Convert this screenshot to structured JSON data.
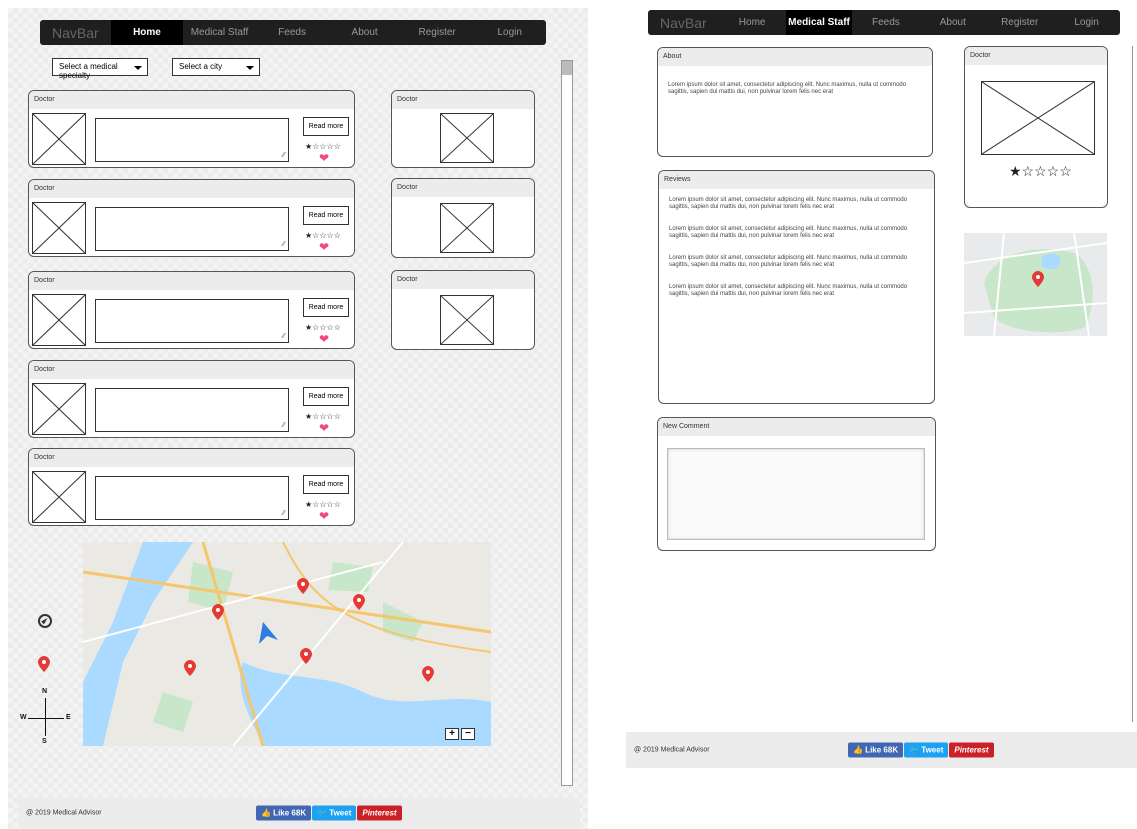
{
  "left": {
    "navbar": {
      "brand": "NavBar",
      "items": [
        "Home",
        "Medical Staff",
        "Feeds",
        "About",
        "Register",
        "Login"
      ],
      "active": "Home"
    },
    "filters": {
      "specialty": "Select a medical specialty",
      "city": "Select a city"
    },
    "cards": [
      {
        "title": "Doctor",
        "button": "Read more",
        "stars": "★☆☆☆☆"
      },
      {
        "title": "Doctor",
        "button": "Read more",
        "stars": "★☆☆☆☆"
      },
      {
        "title": "Doctor",
        "button": "Read more",
        "stars": "★☆☆☆☆"
      },
      {
        "title": "Doctor",
        "button": "Read more",
        "stars": "★☆☆☆☆"
      },
      {
        "title": "Doctor",
        "button": "Read more",
        "stars": "★☆☆☆☆"
      }
    ],
    "side_cards": [
      {
        "title": "Doctor"
      },
      {
        "title": "Doctor"
      },
      {
        "title": "Doctor"
      }
    ],
    "compass": {
      "n": "N",
      "e": "E",
      "s": "S",
      "w": "W"
    },
    "zoom": {
      "plus": "+",
      "minus": "−"
    },
    "footer": {
      "copyright": "@ 2019 Medical Advisor",
      "like": "👍 Like 68K",
      "tweet": "🐦 Tweet",
      "pinterest": "Pinterest"
    }
  },
  "right": {
    "navbar": {
      "brand": "NavBar",
      "items": [
        "Home",
        "Medical Staff",
        "Feeds",
        "About",
        "Register",
        "Login"
      ],
      "active": "Medical Staff"
    },
    "about": {
      "title": "About",
      "text": "Lorem ipsum dolor sit amet, consectetur adipiscing elit. Nunc maximus, nulla ut commodo sagittis, sapien dui mattis dui, non pulvinar lorem felis nec erat"
    },
    "reviews": {
      "title": "Reviews",
      "items": [
        "Lorem ipsum dolor sit amet, consectetur adipiscing elit. Nunc maximus, nulla ut commodo sagittis, sapien dui mattis dui, non pulvinar lorem felis nec erat",
        "Lorem ipsum dolor sit amet, consectetur adipiscing elit. Nunc maximus, nulla ut commodo sagittis, sapien dui mattis dui, non pulvinar lorem felis nec erat",
        "Lorem ipsum dolor sit amet, consectetur adipiscing elit. Nunc maximus, nulla ut commodo sagittis, sapien dui mattis dui, non pulvinar lorem felis nec erat",
        "Lorem ipsum dolor sit amet, consectetur adipiscing elit. Nunc maximus, nulla ut commodo sagittis, sapien dui mattis dui, non pulvinar lorem felis nec erat"
      ]
    },
    "new_comment": {
      "title": "New Comment"
    },
    "doctor": {
      "title": "Doctor",
      "stars": "★☆☆☆☆"
    },
    "footer": {
      "copyright": "@ 2019 Medical Advisor",
      "like": "👍 Like 68K",
      "tweet": "🐦 Tweet",
      "pinterest": "Pinterest"
    }
  },
  "colors": {
    "navbar_bg": "#1f1f1f",
    "heart": "#f2497f",
    "pin": "#e53935",
    "water": "#aadaff",
    "park": "#c8e6c9"
  }
}
